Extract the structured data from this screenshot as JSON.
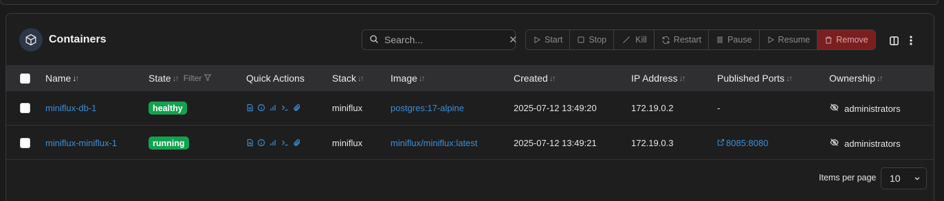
{
  "header": {
    "title": "Containers",
    "search_placeholder": "Search...",
    "actions": [
      {
        "label": "Start",
        "icon": "play-icon"
      },
      {
        "label": "Stop",
        "icon": "stop-icon"
      },
      {
        "label": "Kill",
        "icon": "slash-icon"
      },
      {
        "label": "Restart",
        "icon": "refresh-icon"
      },
      {
        "label": "Pause",
        "icon": "pause-icon"
      },
      {
        "label": "Resume",
        "icon": "play-icon"
      },
      {
        "label": "Remove",
        "icon": "trash-icon"
      }
    ]
  },
  "table": {
    "columns": [
      "Name",
      "State",
      "Quick Actions",
      "Stack",
      "Image",
      "Created",
      "IP Address",
      "Published Ports",
      "Ownership"
    ],
    "state_filter_label": "Filter",
    "rows": [
      {
        "name": "miniflux-db-1",
        "state": "healthy",
        "stack": "miniflux",
        "image": "postgres:17-alpine",
        "created": "2025-07-12 13:49:20",
        "ip": "172.19.0.2",
        "ports": "-",
        "ownership": "administrators"
      },
      {
        "name": "miniflux-miniflux-1",
        "state": "running",
        "stack": "miniflux",
        "image": "miniflux/miniflux:latest",
        "created": "2025-07-12 13:49:21",
        "ip": "172.19.0.3",
        "ports": "8085:8080",
        "ownership": "administrators"
      }
    ]
  },
  "footer": {
    "items_per_page_label": "Items per page",
    "items_per_page_value": "10"
  },
  "colors": {
    "accent": "#3b8fd6",
    "badge_green": "#12a350",
    "remove_red": "#7a1f1f"
  }
}
